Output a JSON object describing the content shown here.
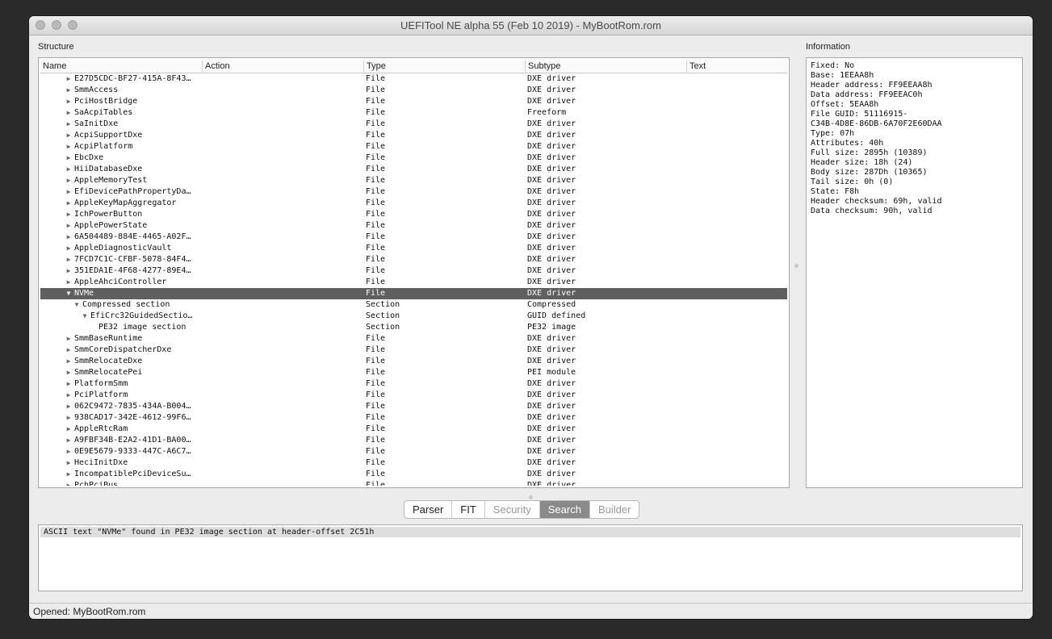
{
  "window": {
    "title": "UEFITool NE alpha 55 (Feb 10 2019) - MyBootRom.rom"
  },
  "structure": {
    "label": "Structure",
    "columns": [
      "Name",
      "Action",
      "Type",
      "Subtype",
      "Text"
    ],
    "rows": [
      {
        "name": "E27D5CDC-BF27-415A-8F43…",
        "type": "File",
        "subtype": "DXE driver",
        "indent": 0,
        "arrow": "right"
      },
      {
        "name": "SmmAccess",
        "type": "File",
        "subtype": "DXE driver",
        "indent": 0,
        "arrow": "right"
      },
      {
        "name": "PciHostBridge",
        "type": "File",
        "subtype": "DXE driver",
        "indent": 0,
        "arrow": "right"
      },
      {
        "name": "SaAcpiTables",
        "type": "File",
        "subtype": "Freeform",
        "indent": 0,
        "arrow": "right"
      },
      {
        "name": "SaInitDxe",
        "type": "File",
        "subtype": "DXE driver",
        "indent": 0,
        "arrow": "right"
      },
      {
        "name": "AcpiSupportDxe",
        "type": "File",
        "subtype": "DXE driver",
        "indent": 0,
        "arrow": "right"
      },
      {
        "name": "AcpiPlatform",
        "type": "File",
        "subtype": "DXE driver",
        "indent": 0,
        "arrow": "right"
      },
      {
        "name": "EbcDxe",
        "type": "File",
        "subtype": "DXE driver",
        "indent": 0,
        "arrow": "right"
      },
      {
        "name": "HiiDatabaseDxe",
        "type": "File",
        "subtype": "DXE driver",
        "indent": 0,
        "arrow": "right"
      },
      {
        "name": "AppleMemoryTest",
        "type": "File",
        "subtype": "DXE driver",
        "indent": 0,
        "arrow": "right"
      },
      {
        "name": "EfiDevicePathPropertyDa…",
        "type": "File",
        "subtype": "DXE driver",
        "indent": 0,
        "arrow": "right"
      },
      {
        "name": "AppleKeyMapAggregator",
        "type": "File",
        "subtype": "DXE driver",
        "indent": 0,
        "arrow": "right"
      },
      {
        "name": "IchPowerButton",
        "type": "File",
        "subtype": "DXE driver",
        "indent": 0,
        "arrow": "right"
      },
      {
        "name": "ApplePowerState",
        "type": "File",
        "subtype": "DXE driver",
        "indent": 0,
        "arrow": "right"
      },
      {
        "name": "6A504489-884E-4465-A02F…",
        "type": "File",
        "subtype": "DXE driver",
        "indent": 0,
        "arrow": "right"
      },
      {
        "name": "AppleDiagnosticVault",
        "type": "File",
        "subtype": "DXE driver",
        "indent": 0,
        "arrow": "right"
      },
      {
        "name": "7FCD7C1C-CFBF-5078-84F4…",
        "type": "File",
        "subtype": "DXE driver",
        "indent": 0,
        "arrow": "right"
      },
      {
        "name": "351EDA1E-4F68-4277-89E4…",
        "type": "File",
        "subtype": "DXE driver",
        "indent": 0,
        "arrow": "right"
      },
      {
        "name": "AppleAhciController",
        "type": "File",
        "subtype": "DXE driver",
        "indent": 0,
        "arrow": "right"
      },
      {
        "name": "NVMe",
        "type": "File",
        "subtype": "DXE driver",
        "indent": 0,
        "arrow": "down",
        "selected": true
      },
      {
        "name": "Compressed section",
        "type": "Section",
        "subtype": "Compressed",
        "indent": 1,
        "arrow": "down"
      },
      {
        "name": "EfiCrc32GuidedSectio…",
        "type": "Section",
        "subtype": "GUID defined",
        "indent": 2,
        "arrow": "down"
      },
      {
        "name": "PE32 image section",
        "type": "Section",
        "subtype": "PE32 image",
        "indent": 3,
        "arrow": ""
      },
      {
        "name": "SmmBaseRuntime",
        "type": "File",
        "subtype": "DXE driver",
        "indent": 0,
        "arrow": "right"
      },
      {
        "name": "SmmCoreDispatcherDxe",
        "type": "File",
        "subtype": "DXE driver",
        "indent": 0,
        "arrow": "right"
      },
      {
        "name": "SmmRelocateDxe",
        "type": "File",
        "subtype": "DXE driver",
        "indent": 0,
        "arrow": "right"
      },
      {
        "name": "SmmRelocatePei",
        "type": "File",
        "subtype": "PEI module",
        "indent": 0,
        "arrow": "right"
      },
      {
        "name": "PlatformSmm",
        "type": "File",
        "subtype": "DXE driver",
        "indent": 0,
        "arrow": "right"
      },
      {
        "name": "PciPlatform",
        "type": "File",
        "subtype": "DXE driver",
        "indent": 0,
        "arrow": "right"
      },
      {
        "name": "062C9472-7835-434A-B004…",
        "type": "File",
        "subtype": "DXE driver",
        "indent": 0,
        "arrow": "right"
      },
      {
        "name": "938CAD17-342E-4612-99F6…",
        "type": "File",
        "subtype": "DXE driver",
        "indent": 0,
        "arrow": "right"
      },
      {
        "name": "AppleRtcRam",
        "type": "File",
        "subtype": "DXE driver",
        "indent": 0,
        "arrow": "right"
      },
      {
        "name": "A9FBF34B-E2A2-41D1-BA00…",
        "type": "File",
        "subtype": "DXE driver",
        "indent": 0,
        "arrow": "right"
      },
      {
        "name": "0E9E5679-9333-447C-A6C7…",
        "type": "File",
        "subtype": "DXE driver",
        "indent": 0,
        "arrow": "right"
      },
      {
        "name": "HeciInitDxe",
        "type": "File",
        "subtype": "DXE driver",
        "indent": 0,
        "arrow": "right"
      },
      {
        "name": "IncompatiblePciDeviceSu…",
        "type": "File",
        "subtype": "DXE driver",
        "indent": 0,
        "arrow": "right"
      },
      {
        "name": "PchPciBus",
        "type": "File",
        "subtype": "DXE driver",
        "indent": 0,
        "arrow": "right"
      }
    ]
  },
  "information": {
    "label": "Information",
    "text": "Fixed: No\nBase: 1EEAA8h\nHeader address: FF9EEAA8h\nData address: FF9EEAC0h\nOffset: 5EAA8h\nFile GUID: 51116915-\nC34B-4D8E-86DB-6A70F2E60DAA\nType: 07h\nAttributes: 40h\nFull size: 2895h (10389)\nHeader size: 18h (24)\nBody size: 287Dh (10365)\nTail size: 0h (0)\nState: F8h\nHeader checksum: 69h, valid\nData checksum: 90h, valid"
  },
  "tabs": [
    {
      "label": "Parser",
      "state": "normal"
    },
    {
      "label": "FIT",
      "state": "normal"
    },
    {
      "label": "Security",
      "state": "disabled"
    },
    {
      "label": "Search",
      "state": "active"
    },
    {
      "label": "Builder",
      "state": "disabled"
    }
  ],
  "messages": {
    "header": "ASCII text \"NVMe\" found in PE32 image section at header-offset 2C51h"
  },
  "status": {
    "text": "Opened: MyBootRom.rom"
  }
}
